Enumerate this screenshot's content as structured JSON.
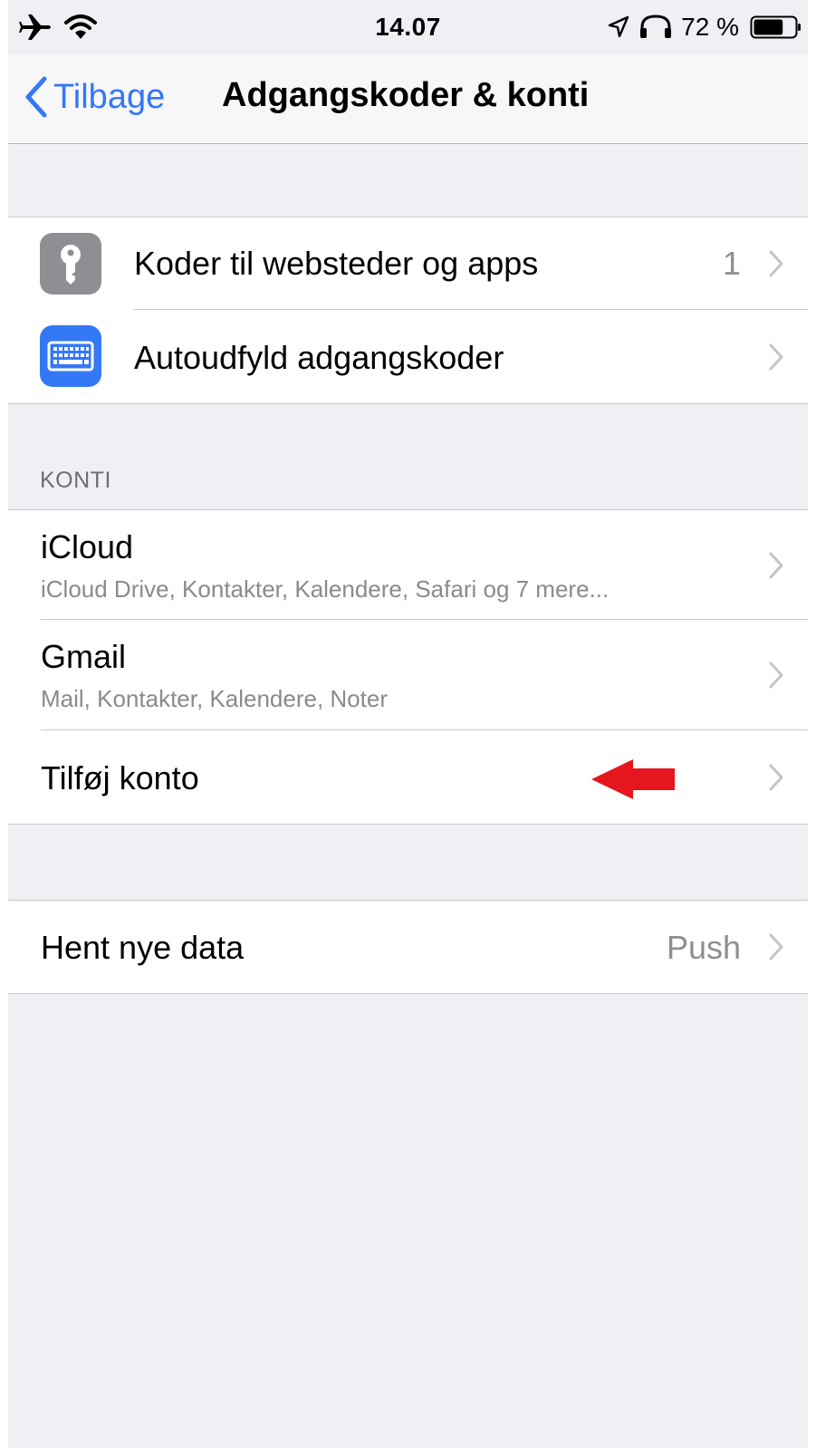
{
  "status_bar": {
    "time": "14.07",
    "battery_percent": "72 %",
    "battery_level": 0.72,
    "icons": [
      "airplane-icon",
      "wifi-icon",
      "location-icon",
      "headphones-icon",
      "battery-icon"
    ]
  },
  "nav": {
    "back_label": "Tilbage",
    "title": "Adgangskoder & konti"
  },
  "passwords_group": {
    "items": [
      {
        "label": "Koder til websteder og apps",
        "value": "1",
        "icon": "key-icon",
        "icon_color": "#8e8e93"
      },
      {
        "label": "Autoudfyld adgangskoder",
        "value": "",
        "icon": "keyboard-icon",
        "icon_color": "#3478f6"
      }
    ]
  },
  "accounts": {
    "header": "KONTI",
    "items": [
      {
        "label": "iCloud",
        "subtitle": "iCloud Drive, Kontakter, Kalendere, Safari og 7 mere..."
      },
      {
        "label": "Gmail",
        "subtitle": "Mail, Kontakter, Kalendere, Noter"
      }
    ],
    "add_account": "Tilføj konto"
  },
  "fetch": {
    "label": "Hent nye data",
    "value": "Push"
  },
  "colors": {
    "accent": "#3478f6",
    "background": "#efeff4",
    "annotation_arrow": "#e5161d"
  }
}
